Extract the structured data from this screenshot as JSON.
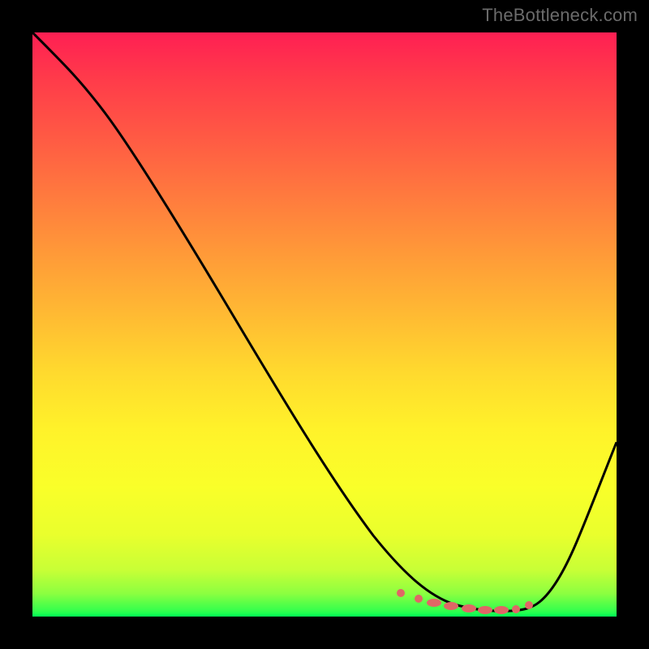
{
  "brand": "TheBottleneck.com",
  "chart_data": {
    "type": "line",
    "title": "",
    "xlabel": "",
    "ylabel": "",
    "xlim": [
      0,
      100
    ],
    "ylim": [
      0,
      100
    ],
    "grid": false,
    "legend": false,
    "background_gradient": {
      "top": "#ff1f53",
      "mid": "#fff22a",
      "bottom": "#00ff55"
    },
    "series": [
      {
        "name": "bottleneck-curve",
        "color": "#000000",
        "x": [
          0,
          4,
          8,
          12,
          16,
          20,
          24,
          28,
          32,
          36,
          40,
          44,
          48,
          52,
          56,
          60,
          64,
          68,
          72,
          76,
          80,
          82,
          85,
          88,
          92,
          96,
          100
        ],
        "values": [
          100,
          98,
          95,
          91,
          86,
          80,
          73,
          65,
          58,
          50,
          43,
          36,
          30,
          24,
          18,
          13,
          9,
          6,
          3,
          1.5,
          1,
          1,
          1.5,
          3,
          8,
          18,
          30
        ]
      },
      {
        "name": "optimal-markers",
        "color": "#e06666",
        "type": "scatter",
        "x": [
          63,
          66,
          68,
          70,
          72,
          74,
          76,
          78,
          80,
          82,
          85
        ],
        "values": [
          4,
          3,
          2.5,
          2,
          1.6,
          1.3,
          1.1,
          1,
          1,
          1.2,
          1.8
        ]
      }
    ]
  }
}
